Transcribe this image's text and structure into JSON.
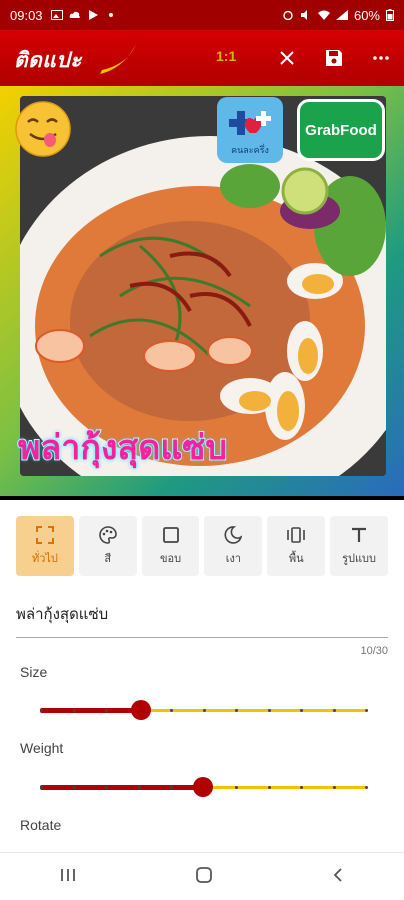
{
  "status_bar": {
    "time": "09:03",
    "battery": "60%"
  },
  "app_bar": {
    "logo_text": "ติดแปะ",
    "ratio_label": "1:1"
  },
  "canvas": {
    "stickers": [
      {
        "name": "emoji-sticker"
      },
      {
        "name": "badge-sticker",
        "label": "คนละครึ่ง"
      },
      {
        "name": "grabfood-sticker",
        "label": "GrabFood"
      }
    ],
    "caption": "พล่ากุ้งสุดแซ่บ"
  },
  "tools": [
    {
      "label": "ทั่วไป",
      "icon": "expand-icon",
      "active": true
    },
    {
      "label": "สี",
      "icon": "palette-icon",
      "active": false
    },
    {
      "label": "ขอบ",
      "icon": "square-outline-icon",
      "active": false
    },
    {
      "label": "เงา",
      "icon": "moon-icon",
      "active": false
    },
    {
      "label": "พื้น",
      "icon": "carousel-icon",
      "active": false
    },
    {
      "label": "รูปแบบ",
      "icon": "text-t-icon",
      "active": false
    }
  ],
  "text_input": {
    "value": "พล่ากุ้งสุดแซ่บ",
    "counter": "10/30"
  },
  "sliders": [
    {
      "label": "Size",
      "value": 0.31
    },
    {
      "label": "Weight",
      "value": 0.5
    },
    {
      "label": "Rotate"
    }
  ],
  "colors": {
    "brand_red": "#b10000",
    "accent_yellow": "#f2c400",
    "active_tool_bg": "#f7cf8e"
  }
}
